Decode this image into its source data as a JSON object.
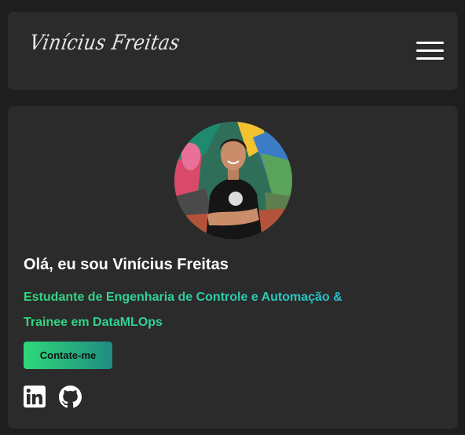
{
  "header": {
    "logo_text": "Vinícius Freitas",
    "menu_icon": "hamburger-menu-icon"
  },
  "profile": {
    "avatar_icon": "profile-photo",
    "greeting": "Olá, eu sou Vinícius Freitas",
    "role_line1": "Estudante de Engenharia de Controle e Automação &",
    "role_line2": "Trainee em DataMLOps",
    "contact_label": "Contate-me"
  },
  "social": [
    {
      "icon": "linkedin-icon"
    },
    {
      "icon": "github-icon"
    }
  ],
  "colors": {
    "background": "#1e1e1e",
    "panel": "#2b2b2b",
    "accent_green": "#35d77c",
    "accent_blue": "#22b6ea"
  }
}
